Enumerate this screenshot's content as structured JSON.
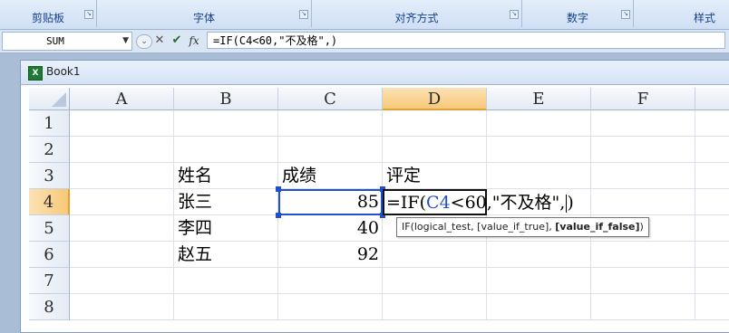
{
  "ribbon": {
    "groups": [
      {
        "label": "剪贴板"
      },
      {
        "label": "字体"
      },
      {
        "label": "对齐方式"
      },
      {
        "label": "数字"
      },
      {
        "label": "样式"
      }
    ]
  },
  "formula_bar": {
    "name_box": "SUM",
    "cancel_glyph": "✕",
    "enter_glyph": "✔",
    "fx_label": "fx",
    "formula": "=IF(C4<60,\"不及格\",)"
  },
  "workbook": {
    "title": "Book1",
    "icon": "excel-workbook-icon"
  },
  "columns": [
    "A",
    "B",
    "C",
    "D",
    "E",
    "F"
  ],
  "rows": [
    "1",
    "2",
    "3",
    "4",
    "5",
    "6",
    "7",
    "8"
  ],
  "cells": {
    "B3": "姓名",
    "C3": "成绩",
    "D3": "评定",
    "B4": "张三",
    "C4": "85",
    "B5": "李四",
    "C5": "40",
    "B6": "赵五",
    "C6": "92"
  },
  "editing": {
    "cell": "D4",
    "prefix": "=IF(",
    "ref": "C4",
    "suffix": "<60,\"不及格\",",
    "close": ")"
  },
  "tooltip": {
    "args": "IF(logical_test, [value_if_true], ",
    "current": "[value_if_false]",
    "end": ")"
  },
  "colors": {
    "selected_header": "#f7c978",
    "reference": "#2050d0",
    "ribbon_text": "#15428b"
  }
}
